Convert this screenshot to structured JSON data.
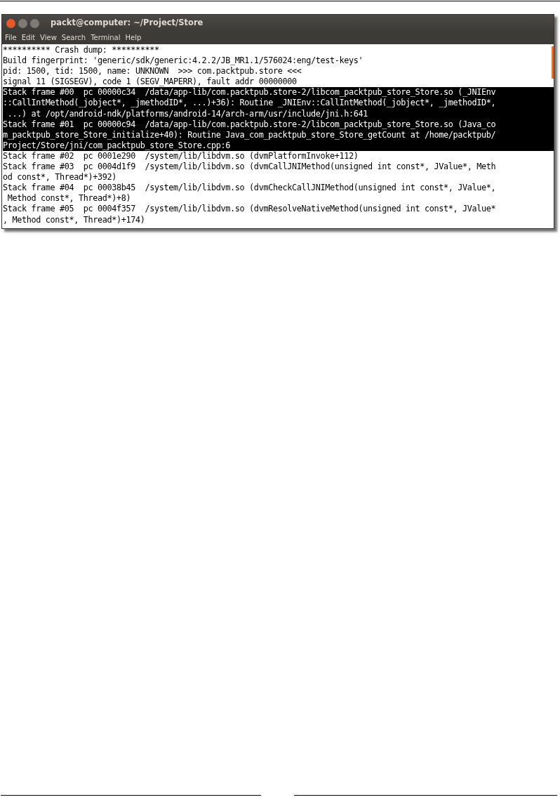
{
  "window": {
    "title": "packt@computer: ~/Project/Store"
  },
  "menu": [
    "File",
    "Edit",
    "View",
    "Search",
    "Terminal",
    "Help"
  ],
  "lines": [
    {
      "text": "********** Crash dump: **********",
      "selected": false
    },
    {
      "text": "Build fingerprint: 'generic/sdk/generic:4.2.2/JB_MR1.1/576024:eng/test-keys'",
      "selected": false
    },
    {
      "text": "pid: 1500, tid: 1500, name: UNKNOWN  >>> com.packtpub.store <<<",
      "selected": false
    },
    {
      "text": "signal 11 (SIGSEGV), code 1 (SEGV_MAPERR), fault addr 00000000",
      "selected": false
    },
    {
      "text": "Stack frame #00  pc 00000c34  /data/app-lib/com.packtpub.store-2/libcom_packtpub_store_Store.so (_JNIEnv",
      "selected": true
    },
    {
      "text": "::CallIntMethod(_jobject*, _jmethodID*, ...)+36): Routine _JNIEnv::CallIntMethod(_jobject*, _jmethodID*,",
      "selected": true
    },
    {
      "text": " ...) at /opt/android-ndk/platforms/android-14/arch-arm/usr/include/jni.h:641",
      "selected": true
    },
    {
      "text": "Stack frame #01  pc 00000c94  /data/app-lib/com.packtpub.store-2/libcom_packtpub_store_Store.so (Java_co",
      "selected": true
    },
    {
      "text": "m_packtpub_store_Store_initialize+40): Routine Java_com_packtpub_store_Store_getCount at /home/packtpub/",
      "selected": true
    },
    {
      "text": "Project/Store/jni/com_packtpub_store_Store.cpp:6",
      "selected": true
    },
    {
      "text": "Stack frame #02  pc 0001e290  /system/lib/libdvm.so (dvmPlatformInvoke+112)",
      "selected": false
    },
    {
      "text": "Stack frame #03  pc 0004d1f9  /system/lib/libdvm.so (dvmCallJNIMethod(unsigned int const*, JValue*, Meth",
      "selected": false
    },
    {
      "text": "od const*, Thread*)+392)",
      "selected": false
    },
    {
      "text": "Stack frame #04  pc 00038b45  /system/lib/libdvm.so (dvmCheckCallJNIMethod(unsigned int const*, JValue*,",
      "selected": false
    },
    {
      "text": " Method const*, Thread*)+8)",
      "selected": false
    },
    {
      "text": "Stack frame #05  pc 0004f357  /system/lib/libdvm.so (dvmResolveNativeMethod(unsigned int const*, JValue*",
      "selected": false
    },
    {
      "text": ", Method const*, Thread*)+174)",
      "selected": false
    }
  ]
}
